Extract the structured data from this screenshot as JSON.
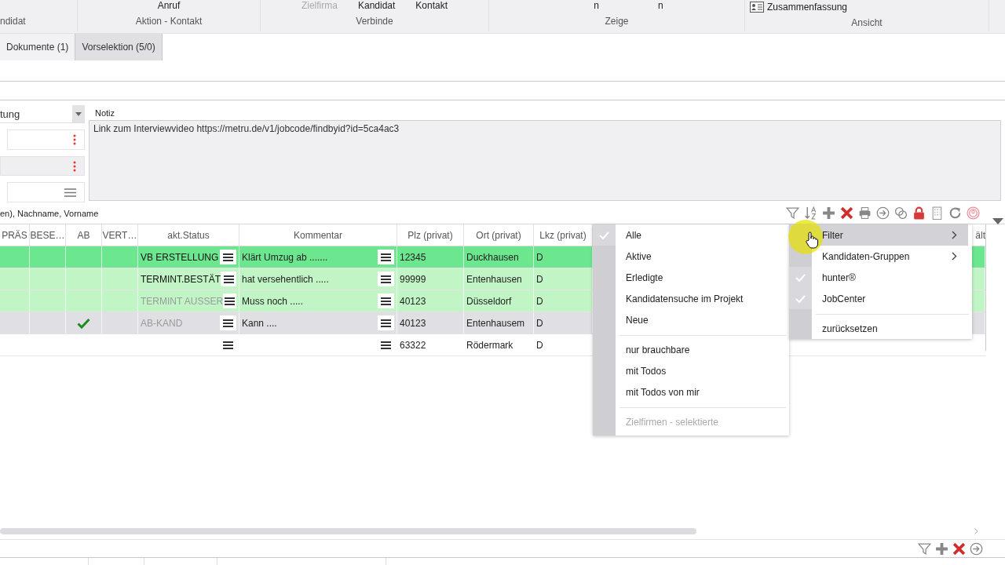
{
  "ribbon": {
    "groups": [
      {
        "label": "ndidat"
      },
      {
        "label": "Aktion - Kontakt",
        "items": [
          {
            "label": "Anruf",
            "disabled": false
          }
        ]
      },
      {
        "label": "Verbinde",
        "items": [
          {
            "label": "Zielfirma",
            "disabled": true
          },
          {
            "label": "Kandidat",
            "disabled": false
          },
          {
            "label": "Kontakt",
            "disabled": false
          }
        ]
      },
      {
        "label": "Zeige",
        "items": [
          {
            "label": "n",
            "disabled": false
          },
          {
            "label": "n",
            "disabled": false
          }
        ]
      },
      {
        "label": "Ansicht",
        "items": [
          {
            "label": "Zusammenfassung",
            "disabled": false,
            "kind": "icon"
          }
        ]
      }
    ]
  },
  "tabs": [
    {
      "label": "Dokumente (1)",
      "selected": false
    },
    {
      "label": "Vorselektion (5/0)",
      "selected": true
    }
  ],
  "form": {
    "select_value": "tung",
    "fields": [
      {
        "kind": "kebab",
        "filled": false
      },
      {
        "kind": "kebab",
        "filled": true
      },
      {
        "kind": "menu",
        "filled": false
      }
    ],
    "note_label": "Notiz",
    "note_value": "Link zum Interviewvideo https://metru.de/v1/jobcode/findbyid?id=5ca4ac3"
  },
  "search_hint": "en), Nachname, Vorname",
  "table": {
    "columns": [
      "PRÄS",
      "BESE…",
      "AB",
      "VERT…",
      "akt.Status",
      "Kommentar",
      "Plz (privat)",
      "Ort (privat)",
      "Lkz (privat)",
      "ält"
    ],
    "rows": [
      {
        "color": "#6ce78f",
        "ab_checked": false,
        "status": "VB ERSTELLUNG",
        "status_muted": false,
        "comment": "Klärt Umzug ab .......",
        "plz": "12345",
        "ort": "Duckhausen",
        "lkz": "D"
      },
      {
        "color": "#c2f5c6",
        "ab_checked": false,
        "status": "TERMINT.BESTÄT",
        "status_muted": false,
        "comment": "hat versehentlich .....",
        "plz": "99999",
        "ort": "Entenhausen",
        "lkz": "D"
      },
      {
        "color": "#c2f5c6",
        "ab_checked": false,
        "status": "TERMINT AUSSER",
        "status_muted": true,
        "comment": "Muss noch  .....",
        "plz": "40123",
        "ort": "Düsseldorf",
        "lkz": "D"
      },
      {
        "color": "#e0dfe3",
        "ab_checked": true,
        "status": "AB-KAND",
        "status_muted": true,
        "comment": "Kann ....",
        "plz": "40123",
        "ort": "Entenhausem",
        "lkz": "D"
      },
      {
        "color": "#ffffff",
        "ab_checked": false,
        "status": "",
        "status_muted": false,
        "comment": "",
        "plz": "63322",
        "ort": "Rödermark",
        "lkz": "D"
      }
    ]
  },
  "context_menu": {
    "groups": [
      [
        {
          "label": "Filter",
          "selected": true,
          "checked": false,
          "submenu": true
        },
        {
          "label": "Kandidaten-Gruppen",
          "selected": false,
          "checked": false,
          "submenu": true
        },
        {
          "label": "hunter®",
          "selected": false,
          "checked": true,
          "submenu": false
        },
        {
          "label": "JobCenter",
          "selected": false,
          "checked": true,
          "submenu": false
        }
      ],
      [
        {
          "label": "zurücksetzen",
          "selected": false,
          "checked": false,
          "submenu": false
        }
      ]
    ]
  },
  "filter_submenu": {
    "groups": [
      [
        {
          "label": "Alle",
          "checked": true,
          "disabled": false
        },
        {
          "label": "Aktive",
          "checked": false,
          "disabled": false
        },
        {
          "label": "Erledigte",
          "checked": false,
          "disabled": false
        },
        {
          "label": "Kandidatensuche im Projekt",
          "checked": false,
          "disabled": false
        },
        {
          "label": "Neue",
          "checked": false,
          "disabled": false
        }
      ],
      [
        {
          "label": "nur brauchbare",
          "checked": false,
          "disabled": false
        },
        {
          "label": "mit Todos",
          "checked": false,
          "disabled": false
        },
        {
          "label": "mit Todos von mir",
          "checked": false,
          "disabled": false
        }
      ],
      [
        {
          "label": "Zielfirmen - selektierte",
          "checked": false,
          "disabled": true
        }
      ]
    ]
  }
}
